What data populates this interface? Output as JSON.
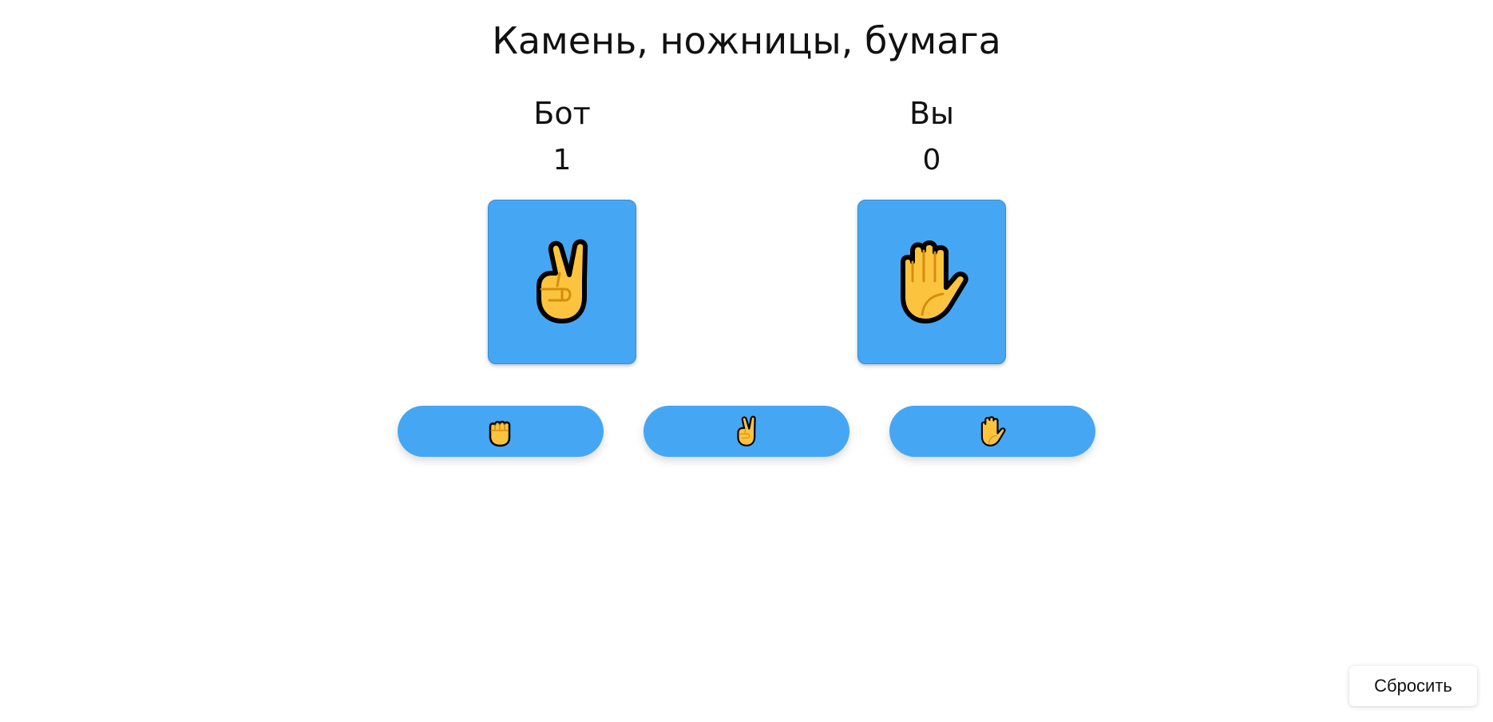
{
  "title": "Камень, ножницы, бумага",
  "bot": {
    "name": "Бот",
    "score": "1",
    "choice": "scissors"
  },
  "player": {
    "name": "Вы",
    "score": "0",
    "choice": "paper"
  },
  "choices": [
    {
      "id": "rock",
      "icon": "raised-fist-icon"
    },
    {
      "id": "scissors",
      "icon": "victory-hand-icon"
    },
    {
      "id": "paper",
      "icon": "raised-hand-icon"
    }
  ],
  "reset_label": "Сбросить",
  "colors": {
    "accent": "#45a7f3",
    "hand_fill": "#fcc43e",
    "hand_outline": "#000000",
    "hand_detail": "#d58d0f"
  }
}
